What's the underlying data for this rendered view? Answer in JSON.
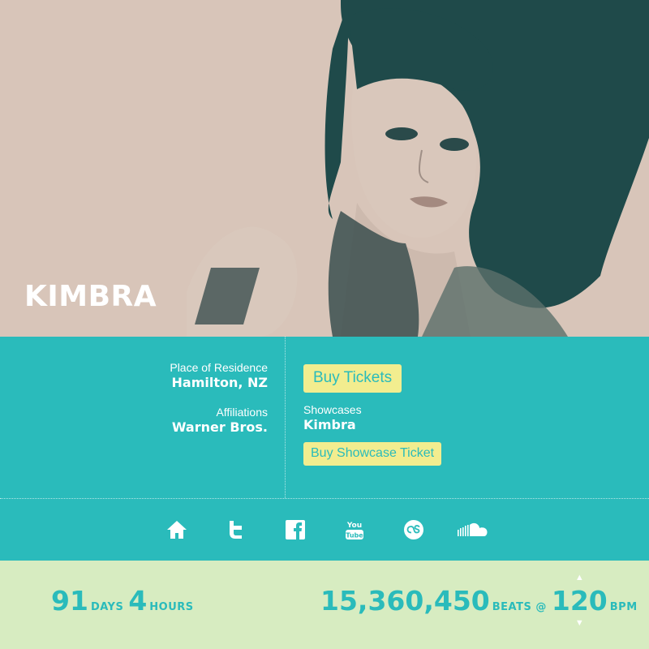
{
  "artist": {
    "name": "KIMBRA"
  },
  "info": {
    "residence_label": "Place of Residence",
    "residence_value": "Hamilton, NZ",
    "affiliations_label": "Affiliations",
    "affiliations_value": "Warner Bros.",
    "buy_tickets_label": "Buy Tickets",
    "showcases_label": "Showcases",
    "showcases_value": "Kimbra",
    "buy_showcase_label": "Buy Showcase Ticket"
  },
  "social": [
    "home-icon",
    "twitter-icon",
    "facebook-icon",
    "youtube-icon",
    "lastfm-icon",
    "soundcloud-icon"
  ],
  "footer": {
    "days_value": "91",
    "days_label": "DAYS",
    "hours_value": "4",
    "hours_label": "HOURS",
    "beats_value": "15,360,450",
    "beats_label": "BEATS @",
    "bpm_value": "120",
    "bpm_label": "BPM"
  },
  "colors": {
    "teal": "#2abbbb",
    "hero_bg": "#d8c5b9",
    "footer_bg": "#d7ecc1",
    "button_yellow": "#f2ed8f"
  }
}
